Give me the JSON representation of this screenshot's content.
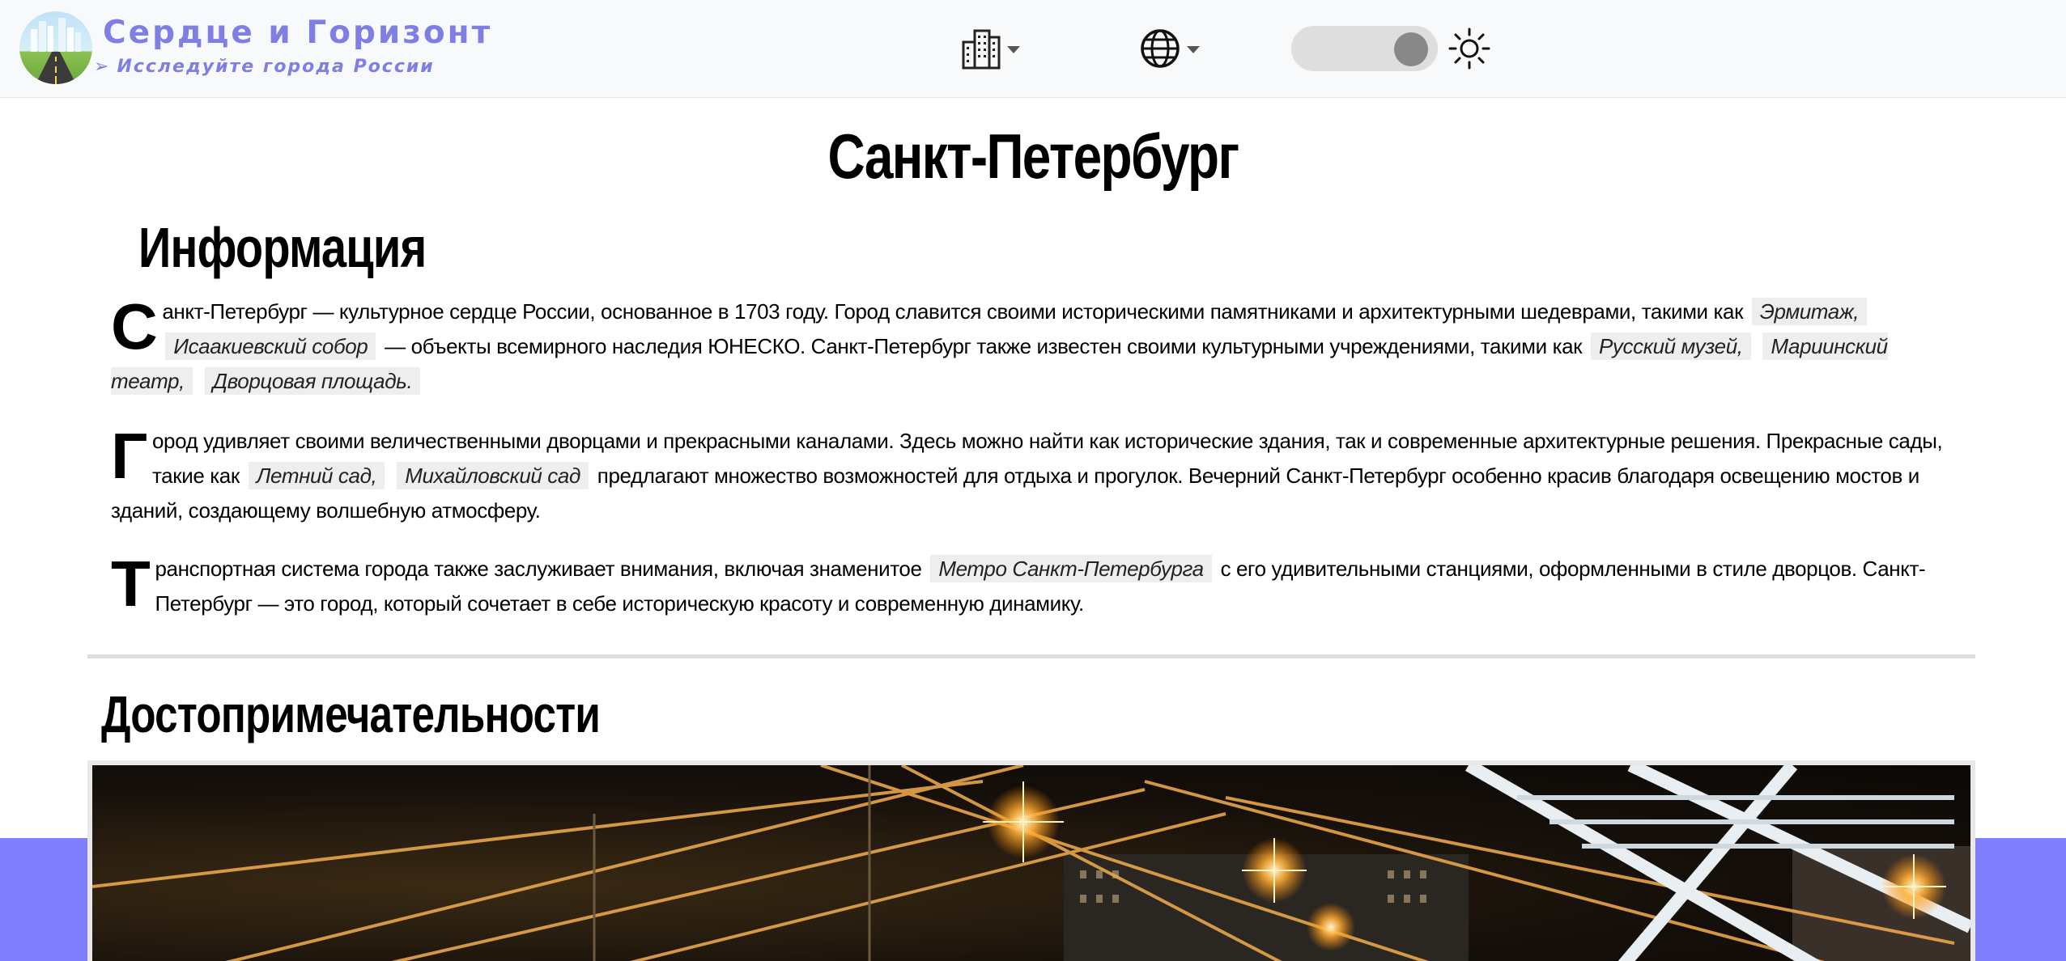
{
  "header": {
    "brand_title": "Сердце и Горизонт",
    "brand_subtitle": "Исследуйте города России",
    "city_menu_icon": "city-buildings-icon",
    "language_menu_icon": "globe-icon",
    "theme_icon": "sun-icon"
  },
  "colors": {
    "brand": "#7f7fe3",
    "accent_band": "#8080ff",
    "tag_background": "#eeeeee"
  },
  "page": {
    "title": "Санкт-Петербург"
  },
  "info": {
    "heading": "Информация",
    "paragraph1": {
      "dropcap": "С",
      "text1": "анкт-Петербург — культурное сердце России, основанное в 1703 году. Город славится своими историческими памятниками и архитектурными шедеврами, такими как",
      "tag1": "Эрмитаж,",
      "tag2": "Исаакиевский собор",
      "text2": "— объекты всемирного наследия ЮНЕСКО. Санкт-Петербург также известен своими культурными учреждениями, такими как",
      "tag3": "Русский музей,",
      "tag4": "Мариинский театр,",
      "tag5": "Дворцовая площадь."
    },
    "paragraph2": {
      "dropcap": "Г",
      "text1": "ород удивляет своими величественными дворцами и прекрасными каналами. Здесь можно найти как исторические здания, так и современные архитектурные решения. Прекрасные сады, такие как",
      "tag1": "Летний сад,",
      "tag2": "Михайловский сад",
      "text2": "предлагают множество возможностей для отдыха и прогулок. Вечерний Санкт-Петербург особенно красив благодаря освещению мостов и зданий, создающему волшебную атмосферу."
    },
    "paragraph3": {
      "dropcap": "Т",
      "text1": "ранспортная система города также заслуживает внимания, включая знаменитое",
      "tag1": "Метро Санкт-Петербурга",
      "text2": "с его удивительными станциями, оформленными в стиле дворцов. Санкт-Петербург — это город, который сочетает в себе историческую красоту и современную динамику."
    }
  },
  "sights": {
    "heading": "Достопримечательности"
  }
}
